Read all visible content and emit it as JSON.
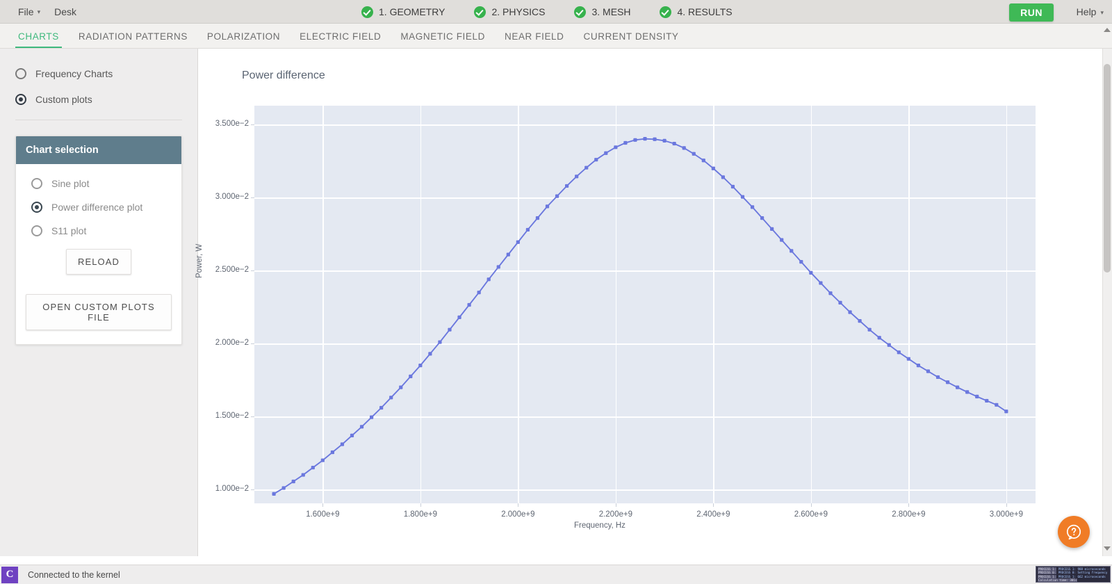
{
  "menubar": {
    "items": [
      {
        "label": "File",
        "has_caret": true,
        "icon": "chevron-down-icon"
      },
      {
        "label": "Desk",
        "has_caret": false
      }
    ],
    "steps": [
      {
        "label": "1. GEOMETRY",
        "icon": "check-circle-icon",
        "complete": true
      },
      {
        "label": "2. PHYSICS",
        "icon": "check-circle-icon",
        "complete": true
      },
      {
        "label": "3. MESH",
        "icon": "check-circle-icon",
        "complete": true
      },
      {
        "label": "4. RESULTS",
        "icon": "check-circle-icon",
        "complete": true
      }
    ],
    "run_label": "RUN",
    "help_label": "Help",
    "run_color": "#3fb956",
    "check_color": "#37b24d"
  },
  "tabs": [
    {
      "label": "CHARTS",
      "active": true
    },
    {
      "label": "RADIATION PATTERNS",
      "active": false
    },
    {
      "label": "POLARIZATION",
      "active": false
    },
    {
      "label": "ELECTRIC FIELD",
      "active": false
    },
    {
      "label": "MAGNETIC FIELD",
      "active": false
    },
    {
      "label": "NEAR FIELD",
      "active": false
    },
    {
      "label": "CURRENT DENSITY",
      "active": false
    }
  ],
  "tab_active_color": "#3fb97d",
  "sidebar": {
    "mode_options": [
      {
        "label": "Frequency Charts",
        "selected": false
      },
      {
        "label": "Custom plots",
        "selected": true
      }
    ],
    "panel": {
      "title": "Chart selection",
      "header_color": "#5f7d8c",
      "options": [
        {
          "label": "Sine plot",
          "selected": false
        },
        {
          "label": "Power difference plot",
          "selected": true
        },
        {
          "label": "S11 plot",
          "selected": false
        }
      ],
      "reload_label": "RELOAD",
      "open_file_label": "OPEN CUSTOM PLOTS FILE"
    }
  },
  "statusbar": {
    "kernel_icon": "jupyter-kernel-icon",
    "kernel_glyph": "C",
    "text": "Connected to the kernel",
    "log": [
      "PROCESS 1: 988 microseconds",
      "PROCESS 0: Setting frequency",
      "PROCESS 1: 662 microseconds",
      "Calculation time: 301s"
    ]
  },
  "fab": {
    "icon": "help-question-icon",
    "color": "#f07c26"
  },
  "chart_data": {
    "type": "line",
    "title": "Power difference",
    "xlabel": "Frequency, Hz",
    "ylabel": "Power, W",
    "line_color": "#6b78de",
    "marker": "square",
    "plot_bg": "#e4e9f2",
    "grid": true,
    "legend": false,
    "xlim": [
      1460000000,
      3060000000
    ],
    "ylim": [
      0.00905,
      0.0363
    ],
    "xticks": [
      1600000000,
      1800000000,
      2000000000,
      2200000000,
      2400000000,
      2600000000,
      2800000000,
      3000000000
    ],
    "xticklabels": [
      "1.600e+9",
      "1.800e+9",
      "2.000e+9",
      "2.200e+9",
      "2.400e+9",
      "2.600e+9",
      "2.800e+9",
      "3.000e+9"
    ],
    "yticks": [
      0.01,
      0.015,
      0.02,
      0.025,
      0.03,
      0.035
    ],
    "yticklabels": [
      "1.000e−2",
      "1.500e−2",
      "2.000e−2",
      "2.500e−2",
      "3.000e−2",
      "3.500e−2"
    ],
    "x": [
      1500000000.0,
      1520000000.0,
      1540000000.0,
      1560000000.0,
      1580000000.0,
      1600000000.0,
      1620000000.0,
      1640000000.0,
      1660000000.0,
      1680000000.0,
      1700000000.0,
      1720000000.0,
      1740000000.0,
      1760000000.0,
      1780000000.0,
      1800000000.0,
      1820000000.0,
      1840000000.0,
      1860000000.0,
      1880000000.0,
      1900000000.0,
      1920000000.0,
      1940000000.0,
      1960000000.0,
      1980000000.0,
      2000000000.0,
      2020000000.0,
      2040000000.0,
      2060000000.0,
      2080000000.0,
      2100000000.0,
      2120000000.0,
      2140000000.0,
      2160000000.0,
      2180000000.0,
      2200000000.0,
      2220000000.0,
      2240000000.0,
      2260000000.0,
      2280000000.0,
      2300000000.0,
      2320000000.0,
      2340000000.0,
      2360000000.0,
      2380000000.0,
      2400000000.0,
      2420000000.0,
      2440000000.0,
      2460000000.0,
      2480000000.0,
      2500000000.0,
      2520000000.0,
      2540000000.0,
      2560000000.0,
      2580000000.0,
      2600000000.0,
      2620000000.0,
      2640000000.0,
      2660000000.0,
      2680000000.0,
      2700000000.0,
      2720000000.0,
      2740000000.0,
      2760000000.0,
      2780000000.0,
      2800000000.0,
      2820000000.0,
      2840000000.0,
      2860000000.0,
      2880000000.0,
      2900000000.0,
      2920000000.0,
      2940000000.0,
      2960000000.0,
      2980000000.0,
      3000000000.0
    ],
    "y": [
      0.0097,
      0.0101,
      0.01055,
      0.011,
      0.0115,
      0.012,
      0.01255,
      0.0131,
      0.0137,
      0.0143,
      0.01495,
      0.0156,
      0.0163,
      0.017,
      0.01775,
      0.0185,
      0.0193,
      0.0201,
      0.02095,
      0.0218,
      0.02265,
      0.0235,
      0.0244,
      0.02525,
      0.0261,
      0.02695,
      0.0278,
      0.0286,
      0.0294,
      0.0301,
      0.0308,
      0.03145,
      0.03205,
      0.0326,
      0.03305,
      0.03345,
      0.03375,
      0.03395,
      0.03403,
      0.034,
      0.0339,
      0.0337,
      0.0334,
      0.033,
      0.03255,
      0.032,
      0.0314,
      0.03075,
      0.03005,
      0.02935,
      0.0286,
      0.02785,
      0.0271,
      0.02635,
      0.0256,
      0.02485,
      0.02415,
      0.02345,
      0.0228,
      0.02215,
      0.02155,
      0.02095,
      0.0204,
      0.0199,
      0.0194,
      0.01895,
      0.0185,
      0.0181,
      0.0177,
      0.01735,
      0.017,
      0.01668,
      0.01637,
      0.01608,
      0.0158,
      0.01535
    ]
  }
}
